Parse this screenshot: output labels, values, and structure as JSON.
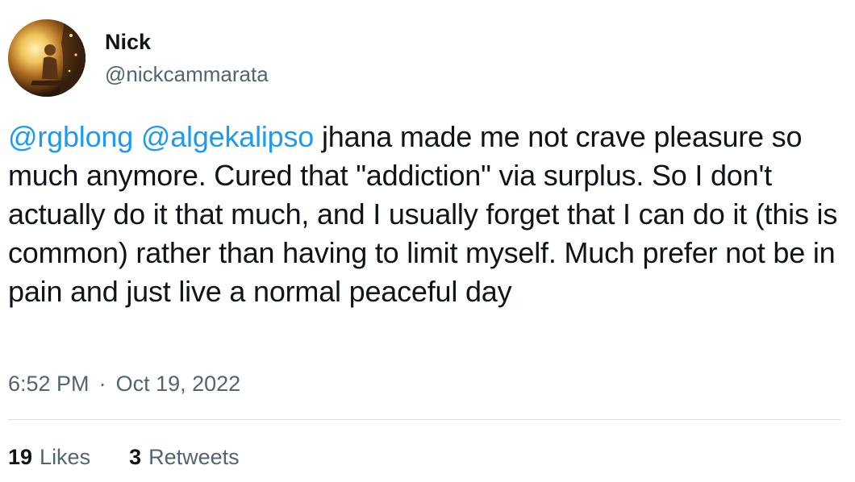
{
  "author": {
    "display_name": "Nick",
    "handle": "@nickcammarata",
    "avatar_icon": "profile-avatar"
  },
  "tweet": {
    "mentions": [
      "@rgblong",
      "@algekalipso"
    ],
    "text": "jhana made me not crave pleasure so much anymore. Cured that \"addiction\" via surplus. So I don't actually do it that much, and I usually forget that I can do it (this is common) rather than having to limit myself. Much prefer not be in pain and just live a normal peaceful day",
    "time": "6:52 PM",
    "separator": "·",
    "date": "Oct 19, 2022"
  },
  "stats": {
    "likes_count": "19",
    "likes_label": "Likes",
    "retweets_count": "3",
    "retweets_label": "Retweets"
  },
  "colors": {
    "mention": "#1d9bf0",
    "text": "#0f1419",
    "secondary": "#536471",
    "divider": "#dde2e6"
  }
}
